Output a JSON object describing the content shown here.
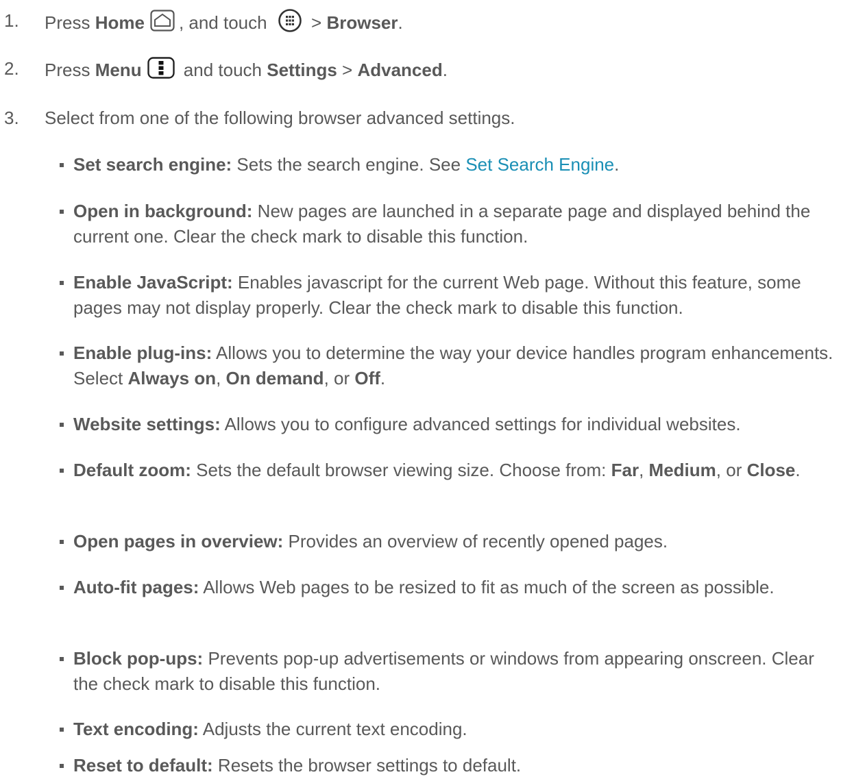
{
  "steps": [
    {
      "num": "1.",
      "pre": "Press ",
      "home": "Home",
      "mid": ", and touch ",
      "gt": " > ",
      "browser": "Browser",
      "end": "."
    },
    {
      "num": "2.",
      "pre": "Press ",
      "menu": "Menu",
      "mid": " and touch ",
      "settings": "Settings",
      "gt": " > ",
      "advanced": "Advanced",
      "end": "."
    },
    {
      "num": "3.",
      "text": "Select from one of the following browser advanced settings."
    }
  ],
  "items": [
    {
      "term": "Set search engine:",
      "desc": " Sets the search engine. See ",
      "link": "Set Search Engine",
      "after": "."
    },
    {
      "term": "Open in background:",
      "desc": " New pages are launched in a separate page and displayed behind the current one. Clear the check mark to disable this function."
    },
    {
      "term": "Enable JavaScript:",
      "desc": " Enables javascript for the current Web page. Without this feature, some pages may not display properly. Clear the check mark to disable this function."
    },
    {
      "term": "Enable plug-ins:",
      "desc": " Allows you to determine the way your device handles program enhancements. Select ",
      "opt1": "Always on",
      "sep1": ", ",
      "opt2": "On demand",
      "sep2": ", or ",
      "opt3": "Off",
      "after": "."
    },
    {
      "term": "Website settings:",
      "desc": " Allows you to configure advanced settings for individual websites."
    },
    {
      "term": "Default zoom:",
      "desc": " Sets the default browser viewing size. Choose from: ",
      "opt1": "Far",
      "sep1": ", ",
      "opt2": "Medium",
      "sep2": ", or ",
      "opt3": "Close",
      "after": "."
    },
    {
      "term": "Open pages in overview:",
      "desc": " Provides an overview of recently opened pages."
    },
    {
      "term": "Auto-fit pages:",
      "desc": " Allows Web pages to be resized to fit as much of the screen as possible."
    },
    {
      "term": "Block pop-ups:",
      "desc": " Prevents pop-up advertisements or windows from appearing onscreen. Clear the check mark to disable this function."
    },
    {
      "term": "Text encoding:",
      "desc": " Adjusts the current text encoding."
    },
    {
      "term": "Reset to default:",
      "desc": " Resets the browser settings to default."
    }
  ],
  "colors": {
    "text": "#595959",
    "link": "#1a8fb5"
  },
  "icons": {
    "home": "home-key-icon",
    "apps": "all-apps-icon",
    "menu": "menu-key-icon"
  }
}
